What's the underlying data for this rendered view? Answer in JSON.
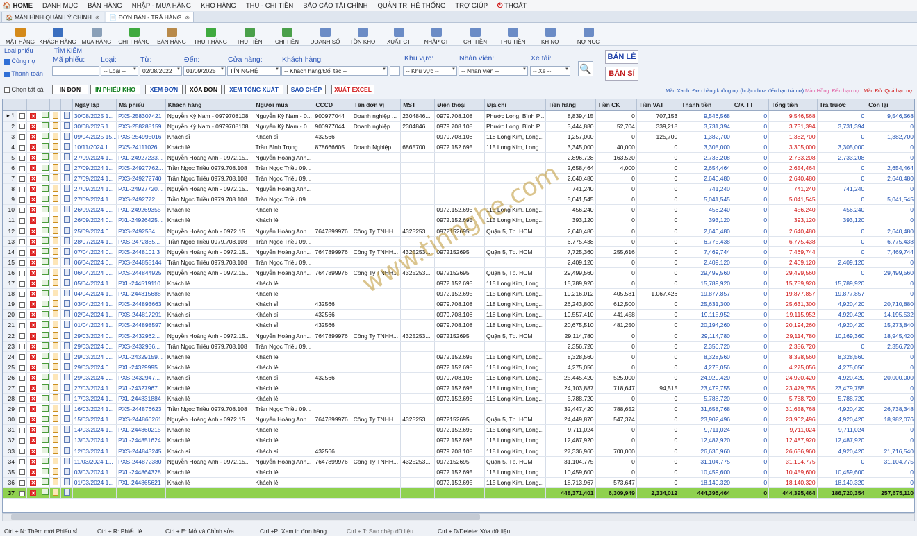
{
  "menu": [
    "HOME",
    "DANH MỤC",
    "BÁN HÀNG",
    "NHẬP - MUA HÀNG",
    "KHO HÀNG",
    "THU - CHI TIỀN",
    "BÁO CÁO TÀI CHÍNH",
    "QUẢN TRỊ HỆ THỐNG",
    "TRỢ GIÚP",
    "THOÁT"
  ],
  "tabs": [
    "MÀN HÌNH QUẢN LÝ CHÍNH",
    "ĐƠN BÁN - TRẢ HÀNG"
  ],
  "toolbar": [
    "MẶT HÀNG",
    "KHÁCH HÀNG",
    "MUA HÀNG",
    "CHI T.HÀNG",
    "BÁN HÀNG",
    "THU T.HÀNG",
    "THU TIỀN",
    "CHI TIỀN",
    "DOANH SỐ",
    "TỒN KHO",
    "XUẤT CT",
    "NHẬP CT",
    "CHI TIỀN",
    "THU TIỀN",
    "KH NỢ",
    "NỢ NCC"
  ],
  "filter": {
    "loai_phieu": "Loại phiếu",
    "cong_no": "Công nợ",
    "thanh_toan": "Thanh toán",
    "chon_tat_ca": "Chọn tất cả",
    "tim_kiem": "TÌM KIẾM",
    "ma_phieu": "Mã phiếu:",
    "loai": "Loại:",
    "tu": "Từ:",
    "den": "Đến:",
    "cua_hang": "Cửa hàng:",
    "khach_hang": "Khách hàng:",
    "khu_vuc": "Khu vực:",
    "nhan_vien": "Nhân viên:",
    "xe_tai": "Xe tải:",
    "loai_val": "-- Loại --",
    "tu_val": "02/08/2022",
    "den_val": "01/09/2025",
    "cua_hang_val": "TÍN NGHỆ",
    "khach_hang_val": "-- Khách hàng/Đối tác --",
    "khu_vuc_val": "-- Khu vực --",
    "nhan_vien_val": "-- Nhân viên --",
    "xe_val": "-- Xe --",
    "ban_le": "BÁN LẺ",
    "ban_si": "BÁN SỈ"
  },
  "actions": [
    "IN ĐƠN",
    "IN PHIẾU KHO",
    "XEM ĐƠN",
    "XÓA ĐƠN",
    "XEM TỔNG XUẤT",
    "SAO CHÉP",
    "XUẤT EXCEL"
  ],
  "legend": {
    "xanh": "Màu Xanh: Đơn hàng không nợ (hoặc chưa đến hạn trả nợ)",
    "hong": "Màu Hồng: Đến hạn nợ",
    "do": "Màu Đỏ: Quá hạn nợ"
  },
  "columns": [
    "Ngày lập",
    "Mã phiếu",
    "Khách hàng",
    "Người mua",
    "CCCD",
    "Tên đơn vị",
    "MST",
    "Điện thoại",
    "Địa chỉ",
    "Tiền hàng",
    "Tiền CK",
    "Tiền VAT",
    "Thành tiền",
    "C/K TT",
    "Tổng tiền",
    "Trả trước",
    "Còn lại"
  ],
  "rows": [
    [
      "30/08/2025 1...",
      "PXS-258307421",
      "Nguyễn Kỳ Nam - 0979708108",
      "Nguyễn Kỳ Nam - 0...",
      "900977044",
      "Doanh nghiệp ...",
      "2304846...",
      "0979.708.108",
      "Phước Long, Bình P...",
      "8,839,415",
      "0",
      "707,153",
      "9,546,568",
      "0",
      "9,546,568",
      "0",
      "9,546,568"
    ],
    [
      "30/08/2025 1...",
      "PXS-258288159",
      "Nguyễn Kỳ Nam - 0979708108",
      "Nguyễn Kỳ Nam - 0...",
      "900977044",
      "Doanh nghiệp ...",
      "2304846...",
      "0979.708.108",
      "Phước Long, Bình P...",
      "3,444,880",
      "52,704",
      "339,218",
      "3,731,394",
      "0",
      "3,731,394",
      "3,731,394",
      "0"
    ],
    [
      "09/04/2025 15...",
      "PXS-254995016",
      "Khách sỉ",
      "Khách sỉ",
      "432566",
      "",
      "",
      "0979.708.108",
      "118 Long Kim, Long...",
      "1,257,000",
      "0",
      "125,700",
      "1,382,700",
      "0",
      "1,382,700",
      "0",
      "1,382,700"
    ],
    [
      "10/11/2024 1...",
      "PXS-24111026...",
      "Khách lẻ",
      "Trần Bình Trọng",
      "878666605",
      "Doanh Nghiệp ...",
      "6865700...",
      "0972.152.695",
      "115 Long Kim, Long...",
      "3,345,000",
      "40,000",
      "0",
      "3,305,000",
      "0",
      "3,305,000",
      "3,305,000",
      "0"
    ],
    [
      "27/09/2024 1...",
      "PXL-24927233...",
      "Nguyễn Hoàng Anh - 0972.15...",
      "Nguyễn Hoàng Anh...",
      "",
      "",
      "",
      "",
      "",
      "2,896,728",
      "163,520",
      "0",
      "2,733,208",
      "0",
      "2,733,208",
      "2,733,208",
      "0"
    ],
    [
      "27/09/2024 1...",
      "PXS-24927762...",
      "Trần Ngọc Triều 0979.708.108",
      "Trần Ngọc Triều 09...",
      "",
      "",
      "",
      "",
      "",
      "2,658,464",
      "4,000",
      "0",
      "2,654,464",
      "0",
      "2,654,464",
      "0",
      "2,654,464"
    ],
    [
      "27/09/2024 1...",
      "PXS-249272740",
      "Trần Ngọc Triều 0979.708.108",
      "Trần Ngọc Triều 09...",
      "",
      "",
      "",
      "",
      "",
      "2,640,480",
      "0",
      "0",
      "2,640,480",
      "0",
      "2,640,480",
      "0",
      "2,640,480"
    ],
    [
      "27/09/2024 1...",
      "PXL-24927720...",
      "Nguyễn Hoàng Anh - 0972.15...",
      "Nguyễn Hoàng Anh...",
      "",
      "",
      "",
      "",
      "",
      "741,240",
      "0",
      "0",
      "741,240",
      "0",
      "741,240",
      "741,240",
      "0"
    ],
    [
      "27/09/2024 1...",
      "PXS-2492772...",
      "Trần Ngọc Triều 0979.708.108",
      "Trần Ngọc Triều 09...",
      "",
      "",
      "",
      "",
      "",
      "5,041,545",
      "0",
      "0",
      "5,041,545",
      "0",
      "5,041,545",
      "0",
      "5,041,545"
    ],
    [
      "26/09/2024 0...",
      "PXL-249269355",
      "Khách lẻ",
      "Khách lẻ",
      "",
      "",
      "",
      "0972.152.695",
      "115 Long Kim, Long...",
      "456,240",
      "0",
      "0",
      "456,240",
      "0",
      "456,240",
      "456,240",
      "0"
    ],
    [
      "26/09/2024 0...",
      "PXL-24926425...",
      "Khách lẻ",
      "Khách lẻ",
      "",
      "",
      "",
      "0972.152.695",
      "115 Long Kim, Long...",
      "393,120",
      "0",
      "0",
      "393,120",
      "0",
      "393,120",
      "393,120",
      "0"
    ],
    [
      "25/09/2024 0...",
      "PXS-2492534...",
      "Nguyễn Hoàng Anh - 0972.15...",
      "Nguyễn Hoàng Anh...",
      "7647899976",
      "Công Ty TNHH...",
      "4325253...",
      "0972152695",
      "Quận 5, Tp. HCM",
      "2,640,480",
      "0",
      "0",
      "2,640,480",
      "0",
      "2,640,480",
      "0",
      "2,640,480"
    ],
    [
      "28/07/2024 1...",
      "PXS-2472885...",
      "Trần Ngọc Triều 0979.708.108",
      "Trần Ngọc Triều 09...",
      "",
      "",
      "",
      "",
      "",
      "6,775,438",
      "0",
      "0",
      "6,775,438",
      "0",
      "6,775,438",
      "0",
      "6,775,438"
    ],
    [
      "07/04/2024 0...",
      "PXS-2448101 3",
      "Nguyễn Hoàng Anh - 0972.15...",
      "Nguyễn Hoàng Anh...",
      "7647899976",
      "Công Ty TNHH...",
      "4325253...",
      "0972152695",
      "Quận 5, Tp. HCM",
      "7,725,360",
      "255,616",
      "0",
      "7,469,744",
      "0",
      "7,469,744",
      "0",
      "7,469,744"
    ],
    [
      "06/04/2024 0...",
      "PXS-244855144",
      "Trần Ngọc Triều 0979.708.108",
      "Trần Ngọc Triều 09...",
      "",
      "",
      "",
      "",
      "",
      "2,409,120",
      "0",
      "0",
      "2,409,120",
      "0",
      "2,409,120",
      "2,409,120",
      "0"
    ],
    [
      "06/04/2024 0...",
      "PXS-244844925",
      "Nguyễn Hoàng Anh - 0972.15...",
      "Nguyễn Hoàng Anh...",
      "7647899976",
      "Công Ty TNHH...",
      "4325253...",
      "0972152695",
      "Quận 5, Tp. HCM",
      "29,499,560",
      "0",
      "0",
      "29,499,560",
      "0",
      "29,499,560",
      "0",
      "29,499,560"
    ],
    [
      "05/04/2024 1...",
      "PXL-244519110",
      "Khách lẻ",
      "Khách lẻ",
      "",
      "",
      "",
      "0972.152.695",
      "115 Long Kim, Long...",
      "15,789,920",
      "0",
      "0",
      "15,789,920",
      "0",
      "15,789,920",
      "15,789,920",
      "0"
    ],
    [
      "04/04/2024 1...",
      "PXL-244815688",
      "Khách lẻ",
      "Khách lẻ",
      "",
      "",
      "",
      "0972.152.695",
      "115 Long Kim, Long...",
      "19,216,012",
      "405,581",
      "1,067,426",
      "19,877,857",
      "0",
      "19,877,857",
      "19,877,857",
      "0"
    ],
    [
      "03/04/2024 1...",
      "PXS-244893663",
      "Khách sỉ",
      "Khách sỉ",
      "432566",
      "",
      "",
      "0979.708.108",
      "118 Long Kim, Long...",
      "26,243,800",
      "612,500",
      "0",
      "25,631,300",
      "0",
      "25,631,300",
      "4,920,420",
      "20,710,880"
    ],
    [
      "02/04/2024 1...",
      "PXS-244817291",
      "Khách sỉ",
      "Khách sỉ",
      "432566",
      "",
      "",
      "0979.708.108",
      "118 Long Kim, Long...",
      "19,557,410",
      "441,458",
      "0",
      "19,115,952",
      "0",
      "19,115,952",
      "4,920,420",
      "14,195,532"
    ],
    [
      "01/04/2024 1...",
      "PXS-244898597",
      "Khách sỉ",
      "Khách sỉ",
      "432566",
      "",
      "",
      "0979.708.108",
      "118 Long Kim, Long...",
      "20,675,510",
      "481,250",
      "0",
      "20,194,260",
      "0",
      "20,194,260",
      "4,920,420",
      "15,273,840"
    ],
    [
      "29/03/2024 0...",
      "PXS-2432962...",
      "Nguyễn Hoàng Anh - 0972.15...",
      "Nguyễn Hoàng Anh...",
      "7647899976",
      "Công Ty TNHH...",
      "4325253...",
      "0972152695",
      "Quận 5, Tp. HCM",
      "29,114,780",
      "0",
      "0",
      "29,114,780",
      "0",
      "29,114,780",
      "10,169,360",
      "18,945,420"
    ],
    [
      "29/03/2024 0...",
      "PXS-2432936...",
      "Trần Ngọc Triều 0979.708.108",
      "Trần Ngọc Triều 09...",
      "",
      "",
      "",
      "",
      "",
      "2,356,720",
      "0",
      "0",
      "2,356,720",
      "0",
      "2,356,720",
      "0",
      "2,356,720"
    ],
    [
      "29/03/2024 0...",
      "PXL-24329159...",
      "Khách lẻ",
      "Khách lẻ",
      "",
      "",
      "",
      "0972.152.695",
      "115 Long Kim, Long...",
      "8,328,560",
      "0",
      "0",
      "8,328,560",
      "0",
      "8,328,560",
      "8,328,560",
      "0"
    ],
    [
      "29/03/2024 0...",
      "PXL-24329995...",
      "Khách lẻ",
      "Khách lẻ",
      "",
      "",
      "",
      "0972.152.695",
      "115 Long Kim, Long...",
      "4,275,056",
      "0",
      "0",
      "4,275,056",
      "0",
      "4,275,056",
      "4,275,056",
      "0"
    ],
    [
      "29/03/2024 0...",
      "PXS-2432947...",
      "Khách sỉ",
      "Khách sỉ",
      "432566",
      "",
      "",
      "0979.708.108",
      "118 Long Kim, Long...",
      "25,445,420",
      "525,000",
      "0",
      "24,920,420",
      "0",
      "24,920,420",
      "4,920,420",
      "20,000,000"
    ],
    [
      "27/03/2024 1...",
      "PXL-24327967...",
      "Khách lẻ",
      "Khách lẻ",
      "",
      "",
      "",
      "0972.152.695",
      "115 Long Kim, Long...",
      "24,103,887",
      "718,647",
      "94,515",
      "23,479,755",
      "0",
      "23,479,755",
      "23,479,755",
      "0"
    ],
    [
      "17/03/2024 1...",
      "PXL-244831884",
      "Khách lẻ",
      "Khách lẻ",
      "",
      "",
      "",
      "0972.152.695",
      "115 Long Kim, Long...",
      "5,788,720",
      "0",
      "0",
      "5,788,720",
      "0",
      "5,788,720",
      "5,788,720",
      "0"
    ],
    [
      "16/03/2024 1...",
      "PXS-244876623",
      "Trần Ngọc Triều 0979.708.108",
      "Trần Ngọc Triều 09...",
      "",
      "",
      "",
      "",
      "",
      "32,447,420",
      "788,652",
      "0",
      "31,658,768",
      "0",
      "31,658,768",
      "4,920,420",
      "26,738,348"
    ],
    [
      "15/03/2024 1...",
      "PXS-244866261",
      "Nguyễn Hoàng Anh - 0972.15...",
      "Nguyễn Hoàng Anh...",
      "7647899976",
      "Công Ty TNHH...",
      "4325253...",
      "0972152695",
      "Quận 5, Tp. HCM",
      "24,449,870",
      "547,374",
      "0",
      "23,902,496",
      "0",
      "23,902,496",
      "4,920,420",
      "18,982,076"
    ],
    [
      "14/03/2024 1...",
      "PXL-244860215",
      "Khách lẻ",
      "Khách lẻ",
      "",
      "",
      "",
      "0972.152.695",
      "115 Long Kim, Long...",
      "9,711,024",
      "0",
      "0",
      "9,711,024",
      "0",
      "9,711,024",
      "9,711,024",
      "0"
    ],
    [
      "13/03/2024 1...",
      "PXL-244851624",
      "Khách lẻ",
      "Khách lẻ",
      "",
      "",
      "",
      "0972.152.695",
      "115 Long Kim, Long...",
      "12,487,920",
      "0",
      "0",
      "12,487,920",
      "0",
      "12,487,920",
      "12,487,920",
      "0"
    ],
    [
      "12/03/2024 1...",
      "PXS-244843245",
      "Khách sỉ",
      "Khách sỉ",
      "432566",
      "",
      "",
      "0979.708.108",
      "118 Long Kim, Long...",
      "27,336,960",
      "700,000",
      "0",
      "26,636,960",
      "0",
      "26,636,960",
      "4,920,420",
      "21,716,540"
    ],
    [
      "11/03/2024 1...",
      "PXS-244872380",
      "Nguyễn Hoàng Anh - 0972.15...",
      "Nguyễn Hoàng Anh...",
      "7647899976",
      "Công Ty TNHH...",
      "4325253...",
      "0972152695",
      "Quận 5, Tp. HCM",
      "31,104,775",
      "0",
      "0",
      "31,104,775",
      "0",
      "31,104,775",
      "0",
      "31,104,775"
    ],
    [
      "03/03/2024 1...",
      "PXL-244864328",
      "Khách lẻ",
      "Khách lẻ",
      "",
      "",
      "",
      "0972.152.695",
      "115 Long Kim, Long...",
      "10,459,600",
      "0",
      "0",
      "10,459,600",
      "0",
      "10,459,600",
      "10,459,600",
      "0"
    ],
    [
      "01/03/2024 1...",
      "PXL-244865621",
      "Khách lẻ",
      "Khách lẻ",
      "",
      "",
      "",
      "0972.152.695",
      "115 Long Kim, Long...",
      "18,713,967",
      "573,647",
      "0",
      "18,140,320",
      "0",
      "18,140,320",
      "18,140,320",
      "0"
    ]
  ],
  "totals": [
    "448,371,401",
    "6,309,949",
    "2,334,012",
    "444,395,464",
    "0",
    "444,395,464",
    "186,720,354",
    "257,675,110"
  ],
  "watermark": "www.tinnghe.com",
  "status": [
    "Ctrl + N: Thêm mới Phiếu sỉ",
    "Ctrl + R: Phiếu lẻ",
    "Ctrl + E: Mở và Chỉnh sửa",
    "Ctrl +P: Xem in đơn hàng",
    "Ctrl + T: Sao chép dữ liệu",
    "Ctrl + D/Delete: Xóa dữ liệu"
  ]
}
